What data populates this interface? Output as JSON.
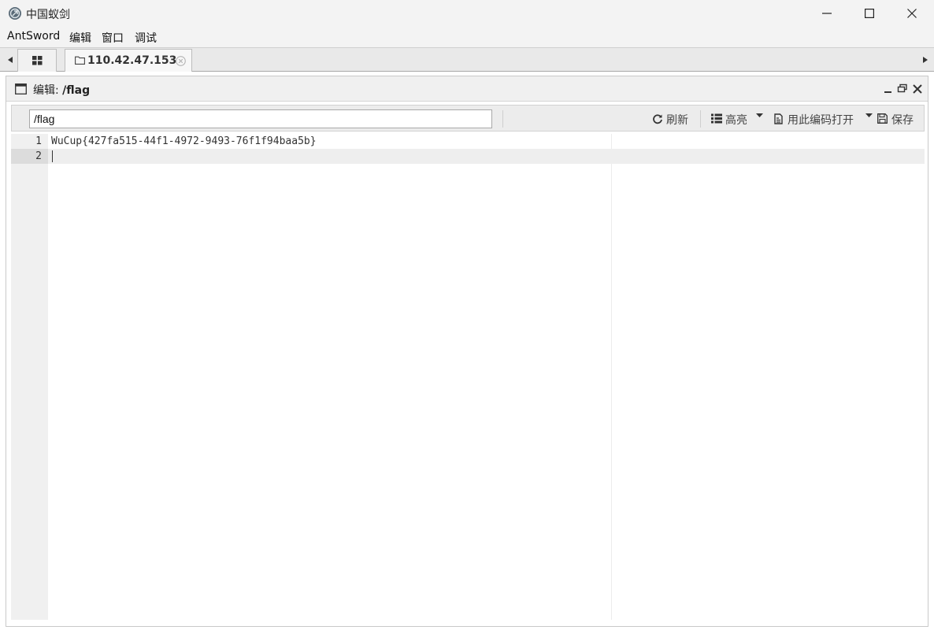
{
  "window": {
    "title": "中国蚁剑"
  },
  "menu": {
    "items": [
      "AntSword",
      "编辑",
      "窗口",
      "调试"
    ]
  },
  "tabs": {
    "host_tab_label": "110.42.47.153"
  },
  "panel": {
    "title_prefix": "编辑:",
    "title_path": "/flag"
  },
  "toolbar": {
    "path_value": "/flag",
    "refresh_label": "刷新",
    "highlight_label": "高亮",
    "open_with_encoding_label": "用此编码打开",
    "save_label": "保存"
  },
  "editor": {
    "lines": [
      {
        "number": "1",
        "text": "WuCup{427fa515-44f1-4972-9493-76f1f94baa5b}"
      },
      {
        "number": "2",
        "text": ""
      }
    ],
    "active_line": 2
  },
  "colors": {
    "titlebar_bg": "#f3f3f3",
    "toolbar_bg": "#ececec",
    "gutter_bg": "#f0f0f0",
    "active_line_bg": "#eeeeee"
  }
}
